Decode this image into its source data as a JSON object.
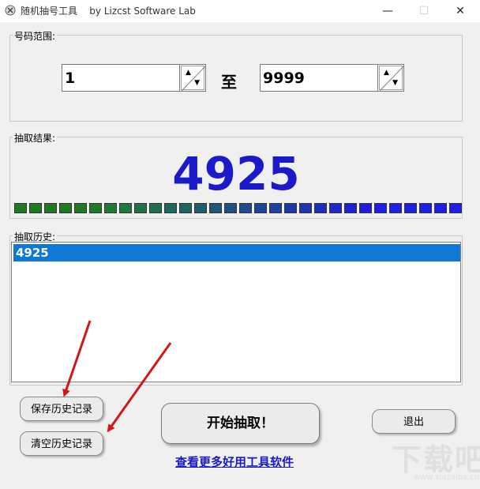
{
  "window": {
    "title": "随机抽号工具",
    "subtitle": "by Lizcst Software Lab",
    "minimize": "—",
    "maximize": "☐",
    "close": "✕"
  },
  "range": {
    "group_label": "号码范围:",
    "from_value": "1",
    "to_label": "至",
    "to_value": "9999",
    "spin_up": "▲",
    "spin_down": "▼"
  },
  "result": {
    "group_label": "抽取结果:",
    "value": "4925",
    "progress_colors": [
      "#1e7a1e",
      "#1e7a1e",
      "#1e7a1e",
      "#1e7a1e",
      "#1e7a1e",
      "#1e7a28",
      "#1e7a32",
      "#1e7a3c",
      "#1e7446",
      "#1e6e50",
      "#1e6a5a",
      "#1e6464",
      "#1e5e6e",
      "#1e5878",
      "#1e5282",
      "#1e4c8c",
      "#1e4696",
      "#1e40a0",
      "#1e3aaa",
      "#1e34b4",
      "#1e2ebe",
      "#1e28c8",
      "#1e22d2",
      "#1e1edc",
      "#1e1ee6",
      "#1e1ee6",
      "#1e1ee6",
      "#1e1ee6",
      "#1e1ee6",
      "#1e1ee6"
    ]
  },
  "history": {
    "group_label": "抽取历史:",
    "items": [
      "4925"
    ]
  },
  "buttons": {
    "save_history": "保存历史记录",
    "clear_history": "清空历史记录",
    "start": "开始抽取！",
    "exit": "退出",
    "more_tools": "查看更多好用工具软件"
  },
  "watermark": {
    "text": "下载吧",
    "url": "www.xiazaiba.com"
  },
  "annotation_color": "#d01818"
}
